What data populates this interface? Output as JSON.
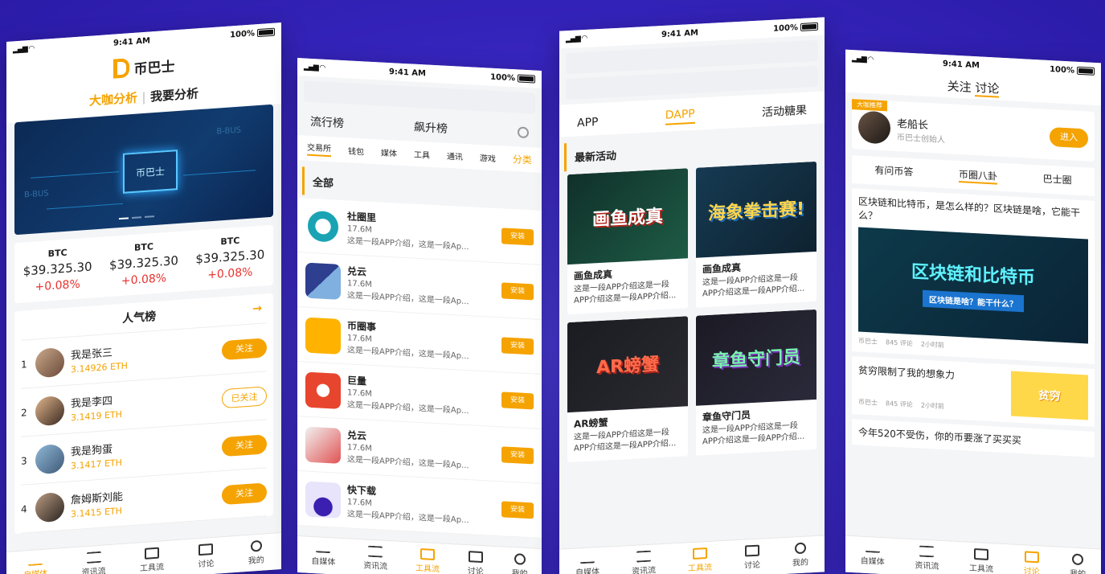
{
  "status": {
    "time": "9:41 AM",
    "battery": "100%"
  },
  "tabbar": [
    "自媒体",
    "资讯流",
    "工具流",
    "讨论",
    "我的"
  ],
  "phone1": {
    "logo": "币巴士",
    "tab_expert": "大咖分析",
    "tab_mine": "我要分析",
    "banner_center": "币巴士",
    "banner_tag": "B-BUS",
    "prices": [
      {
        "symbol": "BTC",
        "value": "$39.325.30",
        "change": "+0.08%"
      },
      {
        "symbol": "BTC",
        "value": "$39.325.30",
        "change": "+0.08%"
      },
      {
        "symbol": "BTC",
        "value": "$39.325.30",
        "change": "+0.08%"
      }
    ],
    "ranking_title": "人气榜",
    "ranking": [
      {
        "num": "1",
        "name": "我是张三",
        "eth": "3.14926 ETH",
        "btn": "关注"
      },
      {
        "num": "2",
        "name": "我是李四",
        "eth": "3.1419 ETH",
        "btn": "已关注"
      },
      {
        "num": "3",
        "name": "我是狗蛋",
        "eth": "3.1417 ETH",
        "btn": "关注"
      },
      {
        "num": "4",
        "name": "詹姆斯刘能",
        "eth": "3.1415 ETH",
        "btn": "关注"
      }
    ]
  },
  "phone2": {
    "tab_popular": "流行榜",
    "tab_rising": "飙升榜",
    "categories": [
      "交易所",
      "钱包",
      "媒体",
      "工具",
      "通讯",
      "游戏"
    ],
    "classify": "分类",
    "section": "全部",
    "install": "安装",
    "apps": [
      {
        "name": "社圈里",
        "size": "17.6M",
        "desc": "这是一段APP介绍，这是一段Ap..."
      },
      {
        "name": "兑云",
        "size": "17.6M",
        "desc": "这是一段APP介绍，这是一段Ap..."
      },
      {
        "name": "币圈事",
        "size": "17.6M",
        "desc": "这是一段APP介绍，这是一段Ap..."
      },
      {
        "name": "巨量",
        "size": "17.6M",
        "desc": "这是一段APP介绍，这是一段Ap..."
      },
      {
        "name": "兑云",
        "size": "17.6M",
        "desc": "这是一段APP介绍，这是一段Ap..."
      },
      {
        "name": "快下载",
        "size": "17.6M",
        "desc": "这是一段APP介绍，这是一段Ap..."
      }
    ]
  },
  "phone3": {
    "tab_app": "APP",
    "tab_dapp": "DAPP",
    "tab_candy": "活动糖果",
    "section": "最新活动",
    "cards": [
      {
        "title": "画鱼成真",
        "img": "画鱼成真",
        "desc": "这是一段APP介绍这是一段APP介绍这是一段APP介绍..."
      },
      {
        "title": "画鱼成真",
        "img": "海象拳击赛!",
        "desc": "这是一段APP介绍这是一段APP介绍这是一段APP介绍..."
      },
      {
        "title": "AR螃蟹",
        "img": "AR螃蟹",
        "desc": "这是一段APP介绍这是一段APP介绍这是一段APP介绍..."
      },
      {
        "title": "章鱼守门员",
        "img": "章鱼守门员",
        "desc": "这是一段APP介绍这是一段APP介绍这是一段APP介绍..."
      }
    ]
  },
  "phone4": {
    "tab_follow": "关注",
    "tab_discuss": "讨论",
    "badge": "大咖推荐",
    "author_name": "老船长",
    "author_sub": "币巴士创始人",
    "enter": "进入",
    "subtabs": [
      "有问币答",
      "币圈八卦",
      "巴士圈"
    ],
    "post1_title": "区块链和比特币，是怎么样的？区块链是啥，它能干么？",
    "post1_banner": "区块链和比特币",
    "post1_banner_sub": "区块链是啥？能干什么？",
    "meta_source": "币巴士",
    "meta_comments": "845 评论",
    "meta_time": "2小时前",
    "post2_title": "贫穷限制了我的想象力",
    "post2_thumb": "贫穷",
    "post3_title": "今年520不受伤，你的币要涨了买买买"
  }
}
